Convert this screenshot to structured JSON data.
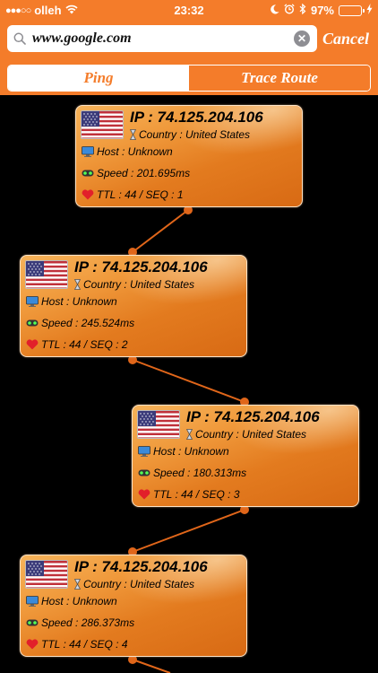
{
  "status_bar": {
    "carrier": "olleh",
    "time": "23:32",
    "battery": "97%"
  },
  "search": {
    "value": "www.google.com",
    "placeholder": "",
    "cancel_label": "Cancel"
  },
  "tabs": [
    {
      "label": "Ping",
      "active": true
    },
    {
      "label": "Trace Route",
      "active": false
    }
  ],
  "colors": {
    "accent": "#f47c2a",
    "background": "#000000"
  },
  "hops": [
    {
      "ip": "IP : 74.125.204.106",
      "country": "Country : United States",
      "host": "Host : Unknown",
      "speed": "Speed : 201.695ms",
      "ttl_seq": "TTL : 44 / SEQ : 1"
    },
    {
      "ip": "IP : 74.125.204.106",
      "country": "Country : United States",
      "host": "Host : Unknown",
      "speed": "Speed : 245.524ms",
      "ttl_seq": "TTL : 44 / SEQ : 2"
    },
    {
      "ip": "IP : 74.125.204.106",
      "country": "Country : United States",
      "host": "Host : Unknown",
      "speed": "Speed : 180.313ms",
      "ttl_seq": "TTL : 44 / SEQ : 3"
    },
    {
      "ip": "IP : 74.125.204.106",
      "country": "Country : United States",
      "host": "Host : Unknown",
      "speed": "Speed : 286.373ms",
      "ttl_seq": "TTL : 44 / SEQ : 4"
    }
  ],
  "icons": {
    "flag": "us-flag-icon",
    "country": "hourglass-icon",
    "host": "monitor-icon",
    "speed": "speed-meter-icon",
    "ttl": "heart-icon"
  }
}
